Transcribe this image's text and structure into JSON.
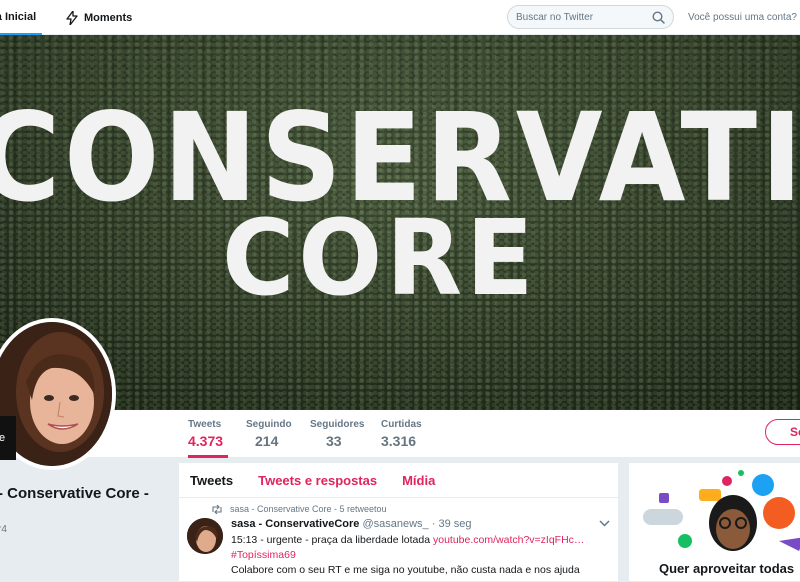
{
  "nav": {
    "home_label": "ina Inicial",
    "moments_label": "Moments",
    "search_placeholder": "Buscar no Twitter",
    "account_question": "Você possui uma conta?"
  },
  "banner": {
    "line1": "CONSERVATIV",
    "line2": "CORE"
  },
  "profile": {
    "name": "- Conservative Core -",
    "handle_fragment": "r4",
    "badge_text": "e"
  },
  "stats": [
    {
      "label": "Tweets",
      "value": "4.373"
    },
    {
      "label": "Seguindo",
      "value": "214"
    },
    {
      "label": "Seguidores",
      "value": "33"
    },
    {
      "label": "Curtidas",
      "value": "3.316"
    }
  ],
  "follow_label": "Se",
  "tabs": [
    "Tweets",
    "Tweets e respostas",
    "Mídia"
  ],
  "tweet": {
    "retweet_context": "sasa - Conservative Core - 5 retweetou",
    "author_name": "sasa - ConservativeCore",
    "author_handle": "@sasanews_",
    "time": "· 39 seg",
    "line1_text": "15:13 - urgente - praça da liberdade lotada ",
    "line1_link": "youtube.com/watch?v=zIqFHc…",
    "hashtag": "#Topíssima69",
    "line3": "Colabore com o seu RT e me siga no youtube, não custa nada e nos ajuda"
  },
  "signup": {
    "title": "Quer aproveitar todas"
  },
  "colors": {
    "accent": "#e0245e",
    "link_blue": "#1da1f2",
    "background": "#e6ecf0"
  }
}
